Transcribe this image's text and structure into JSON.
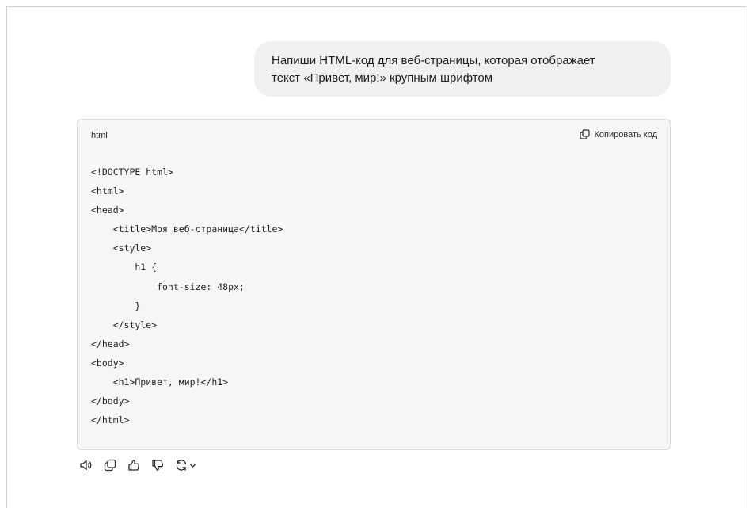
{
  "chat": {
    "user_message": {
      "line1": "Напиши HTML-код для веб-страницы, которая отображает",
      "line2": "текст «Привет, мир!» крупным шрифтом"
    },
    "code_block": {
      "language": "html",
      "copy_label": "Копировать код",
      "lines": [
        "<!DOCTYPE html>",
        "<html>",
        "<head>",
        "    <title>Моя веб-страница</title>",
        "    <style>",
        "        h1 {",
        "            font-size: 48px;",
        "        }",
        "    </style>",
        "</head>",
        "<body>",
        "    <h1>Привет, мир!</h1>",
        "</body>",
        "</html>"
      ]
    },
    "actions": [
      {
        "icon": "speaker-icon"
      },
      {
        "icon": "copy-icon"
      },
      {
        "icon": "thumbs-up-icon"
      },
      {
        "icon": "thumbs-down-icon"
      },
      {
        "icon": "regenerate-icon"
      }
    ]
  }
}
